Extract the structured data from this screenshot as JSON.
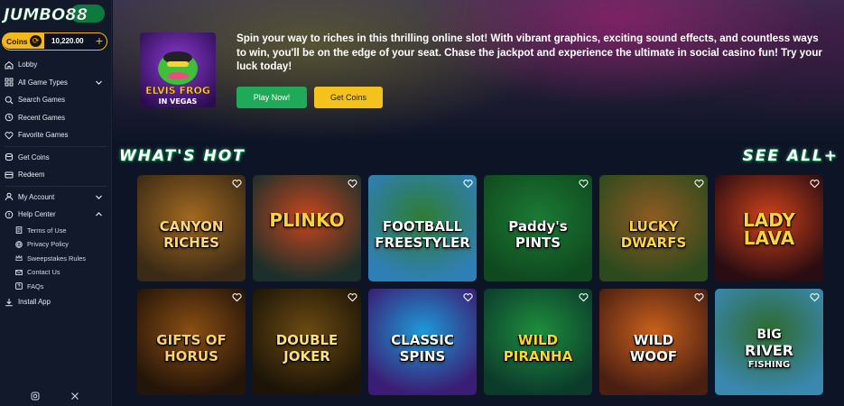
{
  "brand": {
    "logo_text": "JUMBO88"
  },
  "coins": {
    "label": "Coins",
    "balance": "10,220.00",
    "add_symbol": "+"
  },
  "nav": {
    "lobby": "Lobby",
    "all_game_types": "All Game Types",
    "search_games": "Search Games",
    "recent_games": "Recent Games",
    "favorite_games": "Favorite Games",
    "get_coins": "Get Coins",
    "redeem": "Redeem",
    "my_account": "My Account",
    "help_center": "Help Center",
    "help_items": [
      "Terms of Use",
      "Privacy Policy",
      "Sweepstakes Rules",
      "Contact Us",
      "FAQs"
    ],
    "install_app": "Install App"
  },
  "hero": {
    "game_title_line1": "ELVIS FROG",
    "game_title_line2": "IN VEGAS",
    "description": "Spin your way to riches in this thrilling online slot! With vibrant graphics, exciting sound effects, and countless ways to win, you'll be on the edge of your seat. Chase the jackpot and experience the ultimate in social casino fun! Try your luck today!",
    "play_label": "Play Now!",
    "coins_label": "Get Coins"
  },
  "section": {
    "title": "WHAT'S HOT",
    "see_all": "SEE ALL+"
  },
  "games": [
    {
      "line1": "CANYON",
      "line2": "RICHES",
      "bg1": "#3b2a16",
      "bg2": "#a2691f",
      "color": "#ffd77a"
    },
    {
      "line1": "PLINKO",
      "line2": "",
      "bg1": "#1c2f2a",
      "bg2": "#c9461d",
      "color": "#ffd23a"
    },
    {
      "line1": "FOOTBALL",
      "line2": "FREESTYLER",
      "bg1": "#2f7fb7",
      "bg2": "#2e7d32",
      "color": "#ffffff"
    },
    {
      "line1": "Paddy's",
      "line2": "PINTS",
      "bg1": "#0f4a1f",
      "bg2": "#1c7a34",
      "color": "#ffffff"
    },
    {
      "line1": "LUCKY",
      "line2": "DWARFS",
      "bg1": "#2d4a1d",
      "bg2": "#8f5a22",
      "color": "#ffd448"
    },
    {
      "line1": "LADY LAVA",
      "line2": "",
      "bg1": "#2a0d12",
      "bg2": "#d0421a",
      "color": "#ffd33c"
    },
    {
      "line1": "GIFTS OF",
      "line2": "HORUS",
      "bg1": "#241509",
      "bg2": "#8a4e12",
      "color": "#ffd26b"
    },
    {
      "line1": "DOUBLE",
      "line2": "JOKER",
      "bg1": "#1b1407",
      "bg2": "#6b4a12",
      "color": "#ffe07a"
    },
    {
      "line1": "CLASSIC",
      "line2": "SPINS",
      "bg1": "#3a1d74",
      "bg2": "#1d9ad6",
      "color": "#ffffff"
    },
    {
      "line1": "WILD",
      "line2": "PIRANHA",
      "bg1": "#0c3b2c",
      "bg2": "#1d8e3c",
      "color": "#ffd730"
    },
    {
      "line1": "WILD",
      "line2": "WOOF",
      "bg1": "#4a1f12",
      "bg2": "#c9601b",
      "color": "#ffffff"
    },
    {
      "line1": "BIG",
      "line2": "RIVER",
      "line3": "FISHING",
      "bg1": "#3a87b0",
      "bg2": "#2e6a2b",
      "color": "#ffffff"
    }
  ],
  "colors": {
    "accent": "#1fa959",
    "gold": "#f4c21d",
    "background": "#0d1426",
    "sidebar": "#12192b"
  },
  "icons": [
    "home-icon",
    "grid-icon",
    "search-icon",
    "history-icon",
    "heart-icon",
    "coins-icon",
    "redeem-icon",
    "user-icon",
    "help-icon",
    "document-icon",
    "shield-icon",
    "crown-icon",
    "mail-icon",
    "question-icon",
    "download-icon",
    "instagram-icon",
    "x-icon"
  ]
}
